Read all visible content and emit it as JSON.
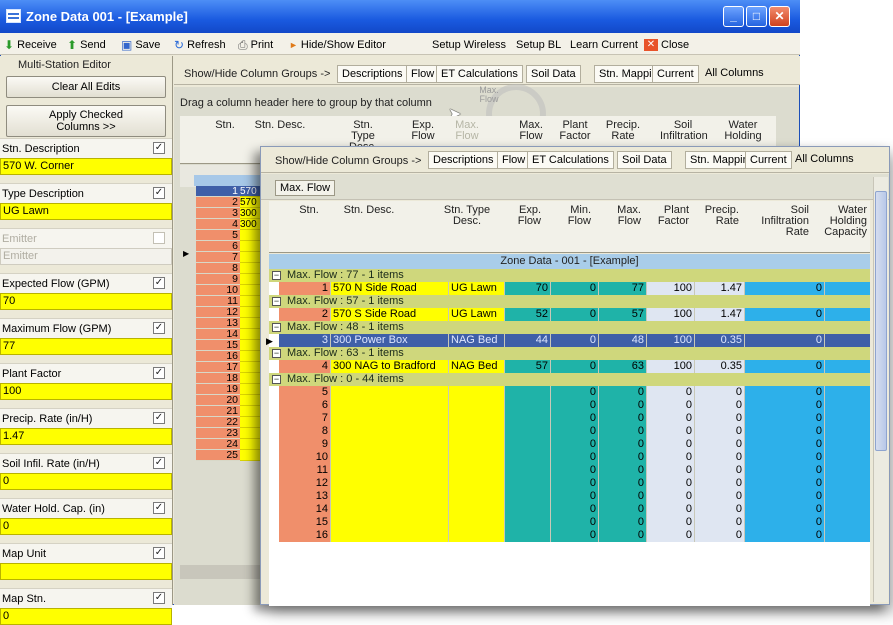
{
  "window": {
    "title": "Zone Data 001 - [Example]"
  },
  "toolbar": {
    "receive": "Receive",
    "send": "Send",
    "save": "Save",
    "refresh": "Refresh",
    "print": "Print",
    "hide_show_editor": "Hide/Show Editor",
    "setup_wireless": "Setup Wireless",
    "setup_bl": "Setup BL",
    "learn_current": "Learn Current",
    "close": "Close"
  },
  "editor": {
    "header": "Multi-Station Editor",
    "clear_label": "Clear All Edits",
    "apply_label": "Apply Checked Columns >>",
    "fields": [
      {
        "label": "Stn. Description",
        "value": "570 W. Corner",
        "checked": true
      },
      {
        "label": "Type Description",
        "value": "UG Lawn",
        "checked": true
      },
      {
        "label": "Emitter",
        "value": "Emitter",
        "checked": false
      },
      {
        "label": "Expected Flow (GPM)",
        "value": "70",
        "checked": true
      },
      {
        "label": "Maximum Flow (GPM)",
        "value": "77",
        "checked": true
      },
      {
        "label": "Plant Factor",
        "value": "100",
        "checked": true
      },
      {
        "label": "Precip. Rate (in/H)",
        "value": "1.47",
        "checked": true
      },
      {
        "label": "Soil Infil. Rate (in/H)",
        "value": "0",
        "checked": true
      },
      {
        "label": "Water Hold. Cap. (in)",
        "value": "0",
        "checked": true
      },
      {
        "label": "Map Unit",
        "value": "",
        "checked": true
      },
      {
        "label": "Map Stn.",
        "value": "0",
        "checked": true
      }
    ]
  },
  "column_groups": {
    "label": "Show/Hide Column Groups ->",
    "tabs": [
      "Descriptions",
      "Flow",
      "ET Calculations",
      "Soil Data",
      "Stn. Mapping",
      "Current",
      "All Columns"
    ]
  },
  "back_grid": {
    "group_hint": "Drag a column header here to group by that column",
    "drag_ghost": "Max. Flow",
    "headers": [
      "Stn.",
      "Stn. Desc.",
      "Stn. Type Desc.",
      "Exp. Flow",
      "Max. Flow",
      "Max. Flow",
      "Plant Factor",
      "Precip. Rate",
      "Soil Infiltration",
      "Water Holding"
    ],
    "rows": [
      {
        "n": "1",
        "d": "570 N"
      },
      {
        "n": "2",
        "d": "570 S"
      },
      {
        "n": "3",
        "d": "300 Po"
      },
      {
        "n": "4",
        "d": "300 NA"
      },
      {
        "n": "5",
        "d": ""
      },
      {
        "n": "6",
        "d": ""
      },
      {
        "n": "7",
        "d": ""
      },
      {
        "n": "8",
        "d": ""
      },
      {
        "n": "9",
        "d": ""
      },
      {
        "n": "10",
        "d": ""
      },
      {
        "n": "11",
        "d": ""
      },
      {
        "n": "12",
        "d": ""
      },
      {
        "n": "13",
        "d": ""
      },
      {
        "n": "14",
        "d": ""
      },
      {
        "n": "15",
        "d": ""
      },
      {
        "n": "16",
        "d": ""
      },
      {
        "n": "17",
        "d": ""
      },
      {
        "n": "18",
        "d": ""
      },
      {
        "n": "19",
        "d": ""
      },
      {
        "n": "20",
        "d": ""
      },
      {
        "n": "21",
        "d": ""
      },
      {
        "n": "22",
        "d": ""
      },
      {
        "n": "23",
        "d": ""
      },
      {
        "n": "24",
        "d": ""
      },
      {
        "n": "25",
        "d": ""
      }
    ]
  },
  "front_grid": {
    "group_chip": "Max. Flow",
    "headers": [
      "Stn.",
      "Stn. Desc.",
      "Stn. Type Desc.",
      "Exp. Flow",
      "Min. Flow",
      "Max. Flow",
      "Plant Factor",
      "Precip. Rate",
      "Soil Infiltration Rate",
      "Water Holding Capacity"
    ],
    "zone_title": "Zone Data - 001 - [Example]",
    "groups": [
      {
        "label": "Max. Flow : 77 - 1 items",
        "rows": [
          [
            "1",
            "570 N Side Road",
            "UG Lawn",
            "70",
            "0",
            "77",
            "100",
            "1.47",
            "0",
            ""
          ]
        ]
      },
      {
        "label": "Max. Flow : 57 - 1 items",
        "rows": [
          [
            "2",
            "570 S Side Road",
            "UG Lawn",
            "52",
            "0",
            "57",
            "100",
            "1.47",
            "0",
            ""
          ]
        ]
      },
      {
        "label": "Max. Flow : 48 - 1 items",
        "rows": [
          [
            "3",
            "300 Power Box",
            "NAG Bed",
            "44",
            "0",
            "48",
            "100",
            "0.35",
            "0",
            ""
          ]
        ]
      },
      {
        "label": "Max. Flow : 63 - 1 items",
        "rows": [
          [
            "4",
            "300 NAG  to Bradford",
            "NAG Bed",
            "57",
            "0",
            "63",
            "100",
            "0.35",
            "0",
            ""
          ]
        ]
      },
      {
        "label": "Max. Flow : 0 - 44 items",
        "rows": [
          [
            "5",
            "",
            "",
            "",
            "0",
            "0",
            "0",
            "0",
            "0",
            ""
          ],
          [
            "6",
            "",
            "",
            "",
            "0",
            "0",
            "0",
            "0",
            "0",
            ""
          ],
          [
            "7",
            "",
            "",
            "",
            "0",
            "0",
            "0",
            "0",
            "0",
            ""
          ],
          [
            "8",
            "",
            "",
            "",
            "0",
            "0",
            "0",
            "0",
            "0",
            ""
          ],
          [
            "9",
            "",
            "",
            "",
            "0",
            "0",
            "0",
            "0",
            "0",
            ""
          ],
          [
            "10",
            "",
            "",
            "",
            "0",
            "0",
            "0",
            "0",
            "0",
            ""
          ],
          [
            "11",
            "",
            "",
            "",
            "0",
            "0",
            "0",
            "0",
            "0",
            ""
          ],
          [
            "12",
            "",
            "",
            "",
            "0",
            "0",
            "0",
            "0",
            "0",
            ""
          ],
          [
            "13",
            "",
            "",
            "",
            "0",
            "0",
            "0",
            "0",
            "0",
            ""
          ],
          [
            "14",
            "",
            "",
            "",
            "0",
            "0",
            "0",
            "0",
            "0",
            ""
          ],
          [
            "15",
            "",
            "",
            "",
            "0",
            "0",
            "0",
            "0",
            "0",
            ""
          ],
          [
            "16",
            "",
            "",
            "",
            "0",
            "0",
            "0",
            "0",
            "0",
            ""
          ]
        ]
      }
    ]
  },
  "colors": {
    "num": "#f08f6b",
    "desc": "#ffff00",
    "flow": "#1fb3a8",
    "ctr": "#dfe6f2",
    "soil": "#2db0ea",
    "selected": "#3f5fa8"
  }
}
